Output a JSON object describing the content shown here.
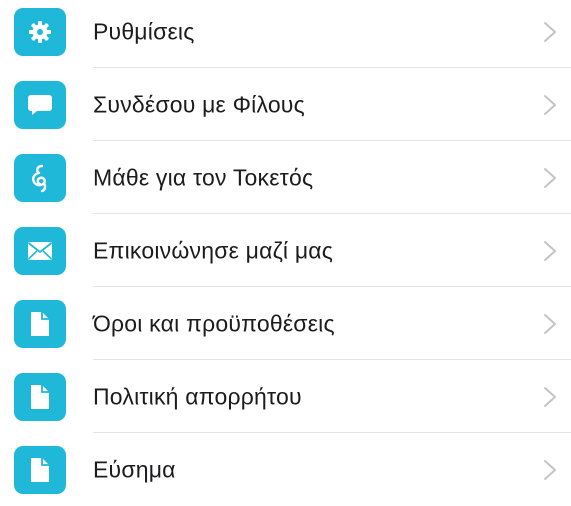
{
  "colors": {
    "accent": "#1fb8d9",
    "text": "#1c1c1e",
    "chevron": "#c4c4c7",
    "divider": "#e3e3e6"
  },
  "menu": {
    "items": [
      {
        "label": "Ρυθμίσεις",
        "icon": "gear-icon"
      },
      {
        "label": "Συνδέσου με Φίλους",
        "icon": "chat-bubble-icon"
      },
      {
        "label": "Μάθε για τον Τοκετός",
        "icon": "pregnancy-icon"
      },
      {
        "label": "Επικοινώνησε μαζί μας",
        "icon": "envelope-icon"
      },
      {
        "label": "Όροι και προϋποθέσεις",
        "icon": "document-icon"
      },
      {
        "label": "Πολιτική απορρήτου",
        "icon": "document-icon"
      },
      {
        "label": "Εύσημα",
        "icon": "document-icon"
      }
    ]
  }
}
